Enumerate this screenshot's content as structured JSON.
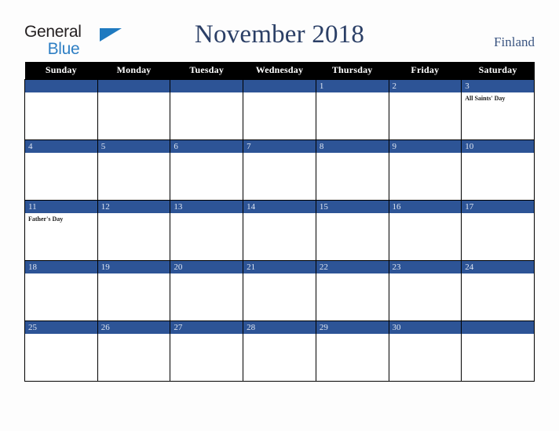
{
  "brand": {
    "name_part1": "General",
    "name_part2": "Blue",
    "triangle_color": "#1f7ac0",
    "text_color": "#231f20",
    "blue_text_color": "#2e7fc4"
  },
  "header": {
    "title": "November 2018",
    "region": "Finland",
    "title_color": "#2b3f66",
    "region_color": "#3c5682"
  },
  "theme": {
    "day_header_bg": "#000000",
    "day_header_text": "#ffffff",
    "date_bar_bg": "#2d5496",
    "date_text": "#dfe6f2",
    "cell_bg": "#ffffff",
    "grid_line": "#000000",
    "page_bg": "#fdfdfd"
  },
  "weekday_headers": [
    "Sunday",
    "Monday",
    "Tuesday",
    "Wednesday",
    "Thursday",
    "Friday",
    "Saturday"
  ],
  "weeks": [
    [
      {
        "date": "",
        "events": []
      },
      {
        "date": "",
        "events": []
      },
      {
        "date": "",
        "events": []
      },
      {
        "date": "",
        "events": []
      },
      {
        "date": "1",
        "events": []
      },
      {
        "date": "2",
        "events": []
      },
      {
        "date": "3",
        "events": [
          "All Saints' Day"
        ]
      }
    ],
    [
      {
        "date": "4",
        "events": []
      },
      {
        "date": "5",
        "events": []
      },
      {
        "date": "6",
        "events": []
      },
      {
        "date": "7",
        "events": []
      },
      {
        "date": "8",
        "events": []
      },
      {
        "date": "9",
        "events": []
      },
      {
        "date": "10",
        "events": []
      }
    ],
    [
      {
        "date": "11",
        "events": [
          "Father's Day"
        ]
      },
      {
        "date": "12",
        "events": []
      },
      {
        "date": "13",
        "events": []
      },
      {
        "date": "14",
        "events": []
      },
      {
        "date": "15",
        "events": []
      },
      {
        "date": "16",
        "events": []
      },
      {
        "date": "17",
        "events": []
      }
    ],
    [
      {
        "date": "18",
        "events": []
      },
      {
        "date": "19",
        "events": []
      },
      {
        "date": "20",
        "events": []
      },
      {
        "date": "21",
        "events": []
      },
      {
        "date": "22",
        "events": []
      },
      {
        "date": "23",
        "events": []
      },
      {
        "date": "24",
        "events": []
      }
    ],
    [
      {
        "date": "25",
        "events": []
      },
      {
        "date": "26",
        "events": []
      },
      {
        "date": "27",
        "events": []
      },
      {
        "date": "28",
        "events": []
      },
      {
        "date": "29",
        "events": []
      },
      {
        "date": "30",
        "events": []
      },
      {
        "date": "",
        "events": []
      }
    ]
  ]
}
